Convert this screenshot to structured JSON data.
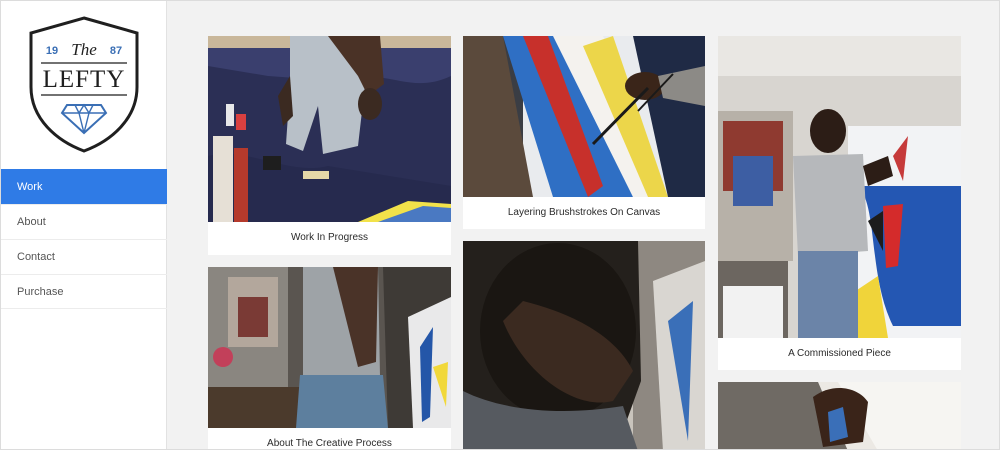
{
  "logo": {
    "line1": "The",
    "year_left": "19",
    "year_right": "87",
    "name": "LEFTY"
  },
  "nav": {
    "items": [
      {
        "label": "Work",
        "active": true
      },
      {
        "label": "About",
        "active": false
      },
      {
        "label": "Contact",
        "active": false
      },
      {
        "label": "Purchase",
        "active": false
      }
    ]
  },
  "gallery": {
    "cards": [
      {
        "caption": "Work In Progress"
      },
      {
        "caption": "About The Creative Process"
      },
      {
        "caption": "Layering Brushstrokes On Canvas"
      },
      {
        "caption": ""
      },
      {
        "caption": "A Commissioned Piece"
      },
      {
        "caption": ""
      }
    ]
  },
  "colors": {
    "accent": "#2f7be6",
    "logo_blue": "#3a6fb5"
  }
}
